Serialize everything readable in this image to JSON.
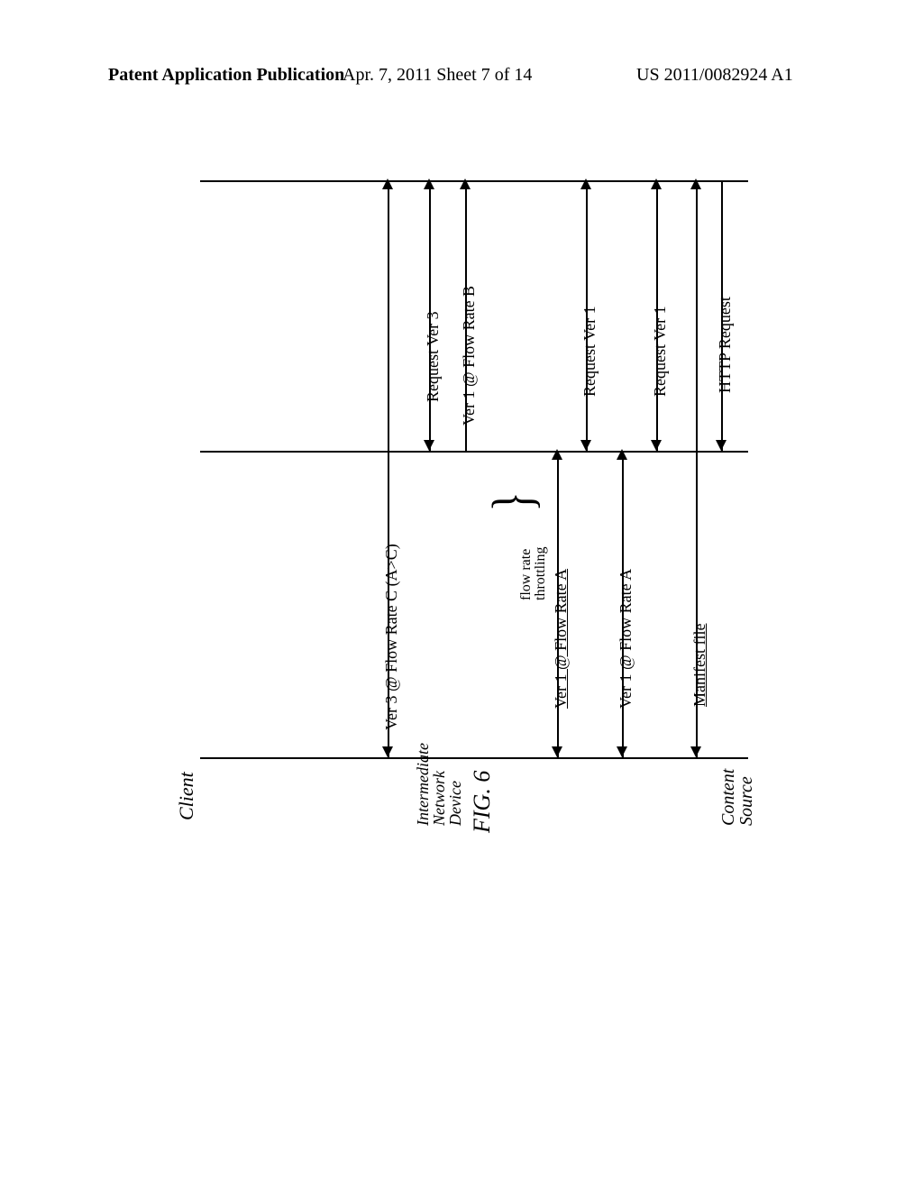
{
  "header": {
    "left": "Patent Application Publication",
    "center": "Apr. 7, 2011  Sheet 7 of 14",
    "right": "US 2011/0082924 A1"
  },
  "figure": {
    "lifelines": {
      "client": "Client",
      "intermediate": "Intermediate\nNetwork\nDevice",
      "content_source": "Content\nSource"
    },
    "messages": {
      "m1": "HTTP Request",
      "m2": "Manifest file",
      "m3": "Request  Ver 1",
      "m4": "Ver 1 @ Flow Rate A",
      "m5": "Request  Ver 1",
      "m6": "Ver 1 @ Flow Rate A",
      "m7": "Ver 1 @ Flow Rate B",
      "m8": "Request  Ver 3",
      "m9": "Ver 3 @ Flow Rate C (A>C)"
    },
    "notes": {
      "throttle": "flow rate\nthrottling"
    },
    "caption": "FIG. 6"
  }
}
